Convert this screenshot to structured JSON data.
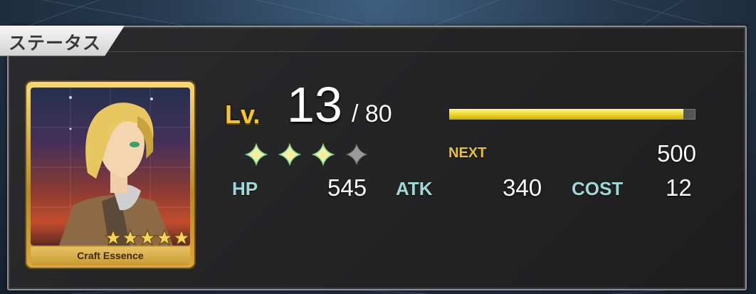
{
  "header": {
    "title": "ステータス"
  },
  "card": {
    "label": "Craft Essence",
    "rarity_stars": 5,
    "art": "portrait-blond-character"
  },
  "level": {
    "prefix": "Lv.",
    "current": "13",
    "max_text": "/ 80",
    "xp_progress": 0.95
  },
  "rarity": {
    "filled": 3,
    "total": 4
  },
  "next": {
    "label": "NEXT",
    "value": "500"
  },
  "stats": {
    "hp_label": "HP",
    "hp_value": "545",
    "atk_label": "ATK",
    "atk_value": "340",
    "cost_label": "COST",
    "cost_value": "12"
  },
  "colors": {
    "gold": "#f2c431",
    "stat_label": "#9fd9d7",
    "xp_bar": "#f2dd2e"
  }
}
